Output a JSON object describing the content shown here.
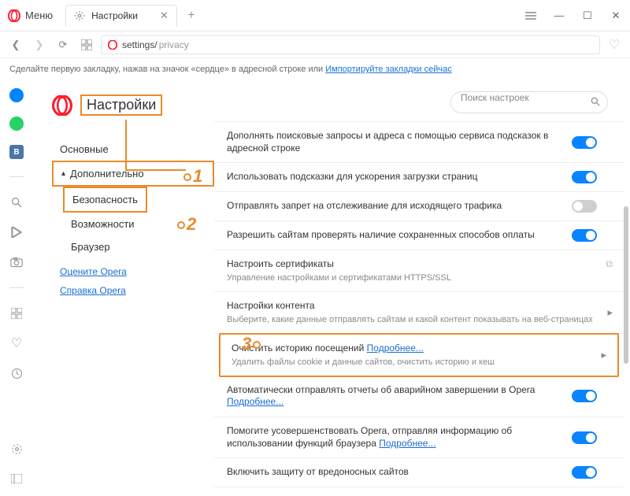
{
  "window": {
    "menu_label": "Меню",
    "tab_title": "Настройки",
    "address_head": "settings/",
    "address_tail": "privacy"
  },
  "hint": {
    "text": "Сделайте первую закладку, нажав на значок «сердце» в адресной строке или ",
    "link": "Импортируйте закладки сейчас"
  },
  "sidebar": {
    "title": "Настройки",
    "items": {
      "basic": "Основные",
      "advanced": "Дополнительно",
      "security": "Безопасность",
      "features": "Возможности",
      "browser": "Браузер"
    },
    "links": {
      "rate": "Оцените Opera",
      "help": "Справка Opera"
    }
  },
  "search": {
    "placeholder": "Поиск настроек"
  },
  "settings": [
    {
      "title": "Дополнять поисковые запросы и адреса с помощью сервиса подсказок в адресной строке",
      "toggle": "on"
    },
    {
      "title": "Использовать подсказки для ускорения загрузки страниц",
      "toggle": "on"
    },
    {
      "title": "Отправлять запрет на отслеживание для исходящего трафика",
      "toggle": "off"
    },
    {
      "title": "Разрешить сайтам проверять наличие сохраненных способов оплаты",
      "toggle": "on"
    },
    {
      "title": "Настроить сертификаты",
      "sub": "Управление настройками и сертификатами HTTPS/SSL",
      "ext": true
    },
    {
      "title": "Настройки контента",
      "sub": "Выберите, какие данные отправлять сайтам и какой контент показывать на веб-страницах",
      "chev": true
    },
    {
      "title": "Очистить историю посещений",
      "link": "Подробнее...",
      "sub": "Удалить файлы cookie и данные сайтов, очистить историю и кеш",
      "chev": true,
      "highlight": true
    },
    {
      "title": "Автоматически отправлять отчеты об аварийном завершении в Opera",
      "link": "Подробнее...",
      "toggle": "on"
    },
    {
      "title": "Помогите усовершенствовать Opera, отправляя информацию об использовании функций браузера",
      "link": "Подробнее...",
      "toggle": "on"
    },
    {
      "title": "Включить защиту от вредоносных сайтов",
      "toggle": "on"
    }
  ],
  "markers": {
    "m1": "1",
    "m2": "2",
    "m3": "3"
  }
}
